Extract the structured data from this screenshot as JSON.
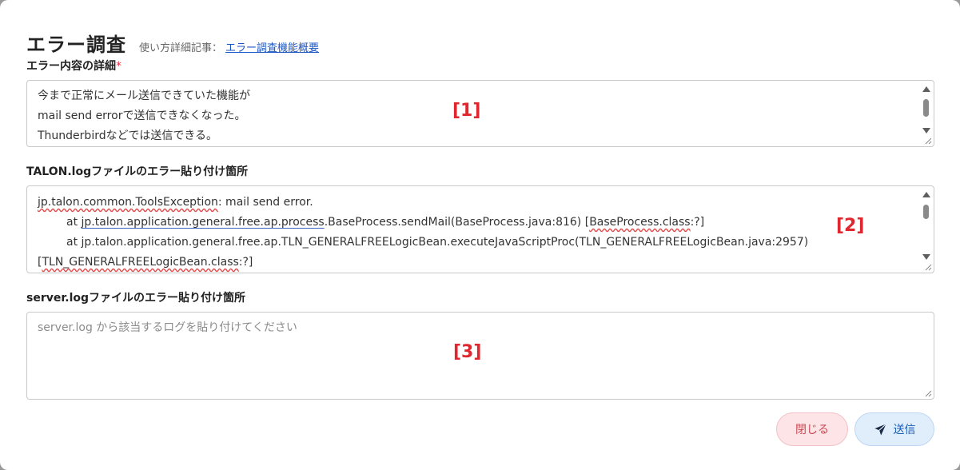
{
  "dialog": {
    "title": "エラー調査",
    "usage_prefix": "使い方詳細記事：",
    "usage_link": "エラー調査機能概要"
  },
  "fields": {
    "detail": {
      "label": "エラー内容の詳細",
      "required_mark": "*",
      "lines": [
        "今まで正常にメール送信できていた機能が",
        "mail send errorで送信できなくなった。",
        "Thunderbirdなどでは送信できる。"
      ]
    },
    "talon_log": {
      "label": "TALON.logファイルのエラー貼り付け箇所",
      "line1": {
        "a": "jp.talon.common.ToolsException",
        "b": ": mail send error."
      },
      "line2": {
        "a": "at ",
        "b": "jp.talon.application.general.free.ap.process",
        "c": ".BaseProcess.sendMail(BaseProcess.java:816) [",
        "d": "BaseProcess.class",
        "e": ":?]"
      },
      "line3": "at jp.talon.application.general.free.ap.TLN_GENERALFREELogicBean.executeJavaScriptProc(TLN_GENERALFREELogicBean.java:2957)",
      "line4": {
        "a": "[",
        "b": "TLN_GENERALFREELogicBean.class",
        "c": ":?]"
      }
    },
    "server_log": {
      "label": "server.logファイルのエラー貼り付け箇所",
      "placeholder": "server.log から該当するログを貼り付けてください"
    }
  },
  "markers": [
    "[1]",
    "[2]",
    "[3]"
  ],
  "buttons": {
    "close": "閉じる",
    "send": "送信"
  },
  "icons": {
    "send": "paper-plane-icon"
  },
  "colors": {
    "marker": "#e0262e",
    "close_bg": "#fde4e6",
    "send_bg": "#e0eefc",
    "link": "#1a55c4"
  }
}
